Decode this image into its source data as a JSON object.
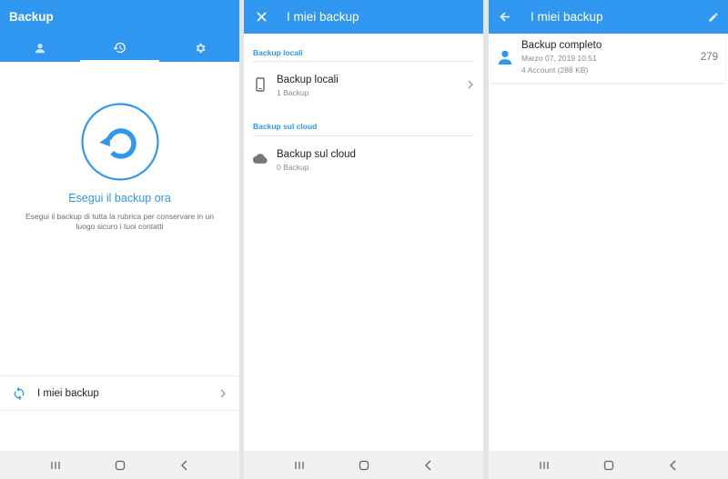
{
  "panel_backup": {
    "title": "Backup",
    "tabs": [
      "contacts-icon",
      "history-icon",
      "settings-icon"
    ],
    "selected_tab": 1,
    "hero_title": "Esegui il backup ora",
    "hero_description": "Esegui il backup di tutta la rubrica per conservare in un luogo sicuro i tuoi contatti",
    "my_backups_label": "I miei backup"
  },
  "panel_list": {
    "title": "I miei backup",
    "local_section": "Backup locali",
    "local_item": {
      "title": "Backup locali",
      "subtitle": "1 Backup"
    },
    "cloud_section": "Backup sul cloud",
    "cloud_item": {
      "title": "Backup sul cloud",
      "subtitle": "0 Backup"
    }
  },
  "panel_detail": {
    "title": "I miei backup",
    "backup": {
      "title": "Backup completo",
      "date": "Marzo 07, 2019 10:51",
      "accounts": "4 Account (288 KB)",
      "count": "279"
    }
  },
  "colors": {
    "accent": "#3097f0",
    "nav_bg": "#f0f0f0"
  }
}
